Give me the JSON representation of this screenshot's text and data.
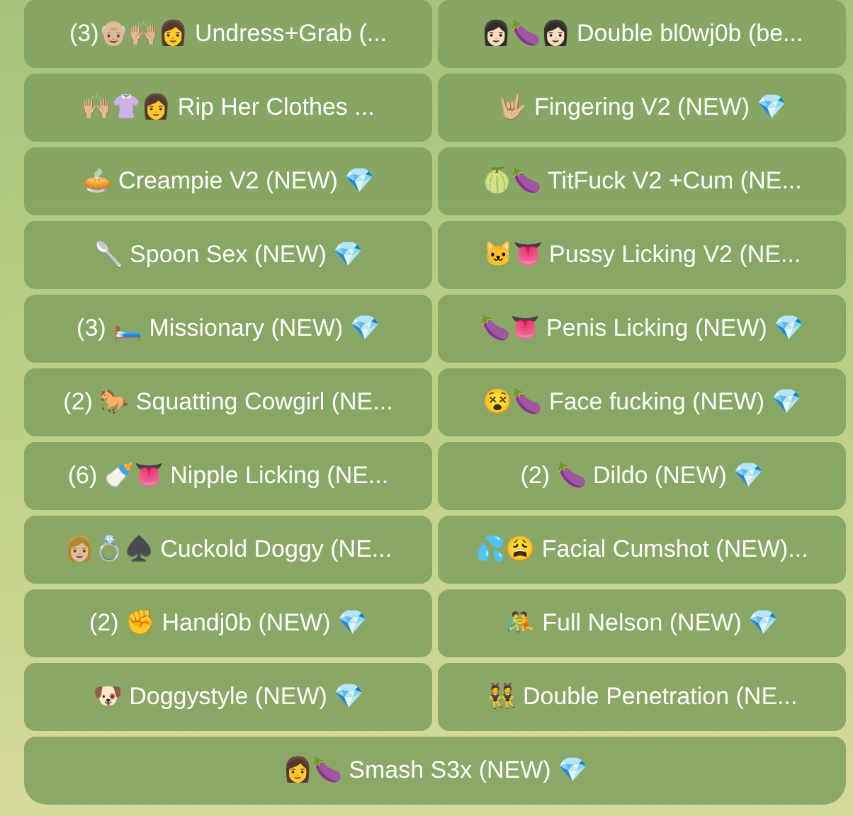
{
  "keyboard": [
    {
      "label": "(3)👴🏼🙌🏼👩 Undress+Grab (..."
    },
    {
      "label": "👩🏻🍆👩🏻 Double bl0wj0b (be..."
    },
    {
      "label": "🙌🏼👚👩 Rip Her Clothes ..."
    },
    {
      "label": "🤟🏼 Fingering V2 (NEW) 💎"
    },
    {
      "label": "🥧 Creampie V2 (NEW) 💎"
    },
    {
      "label": "🍈🍆 TitFuck V2 +Cum (NE..."
    },
    {
      "label": "🥄 Spoon Sex (NEW) 💎"
    },
    {
      "label": "🐱👅 Pussy Licking V2 (NE..."
    },
    {
      "label": "(3) 🛏️ Missionary (NEW) 💎"
    },
    {
      "label": "🍆👅 Penis Licking (NEW) 💎"
    },
    {
      "label": "(2) 🐎 Squatting Cowgirl (NE..."
    },
    {
      "label": "😵🍆 Face fucking (NEW) 💎"
    },
    {
      "label": "(6) 🍼👅 Nipple Licking (NE..."
    },
    {
      "label": "(2) 🍆 Dildo (NEW) 💎"
    },
    {
      "label": "👩🏼💍♠️ Cuckold Doggy (NE..."
    },
    {
      "label": "💦😩 Facial Cumshot (NEW)..."
    },
    {
      "label": "(2) ✊ Handj0b (NEW) 💎"
    },
    {
      "label": "🤼 Full Nelson (NEW) 💎"
    },
    {
      "label": "🐶 Doggystyle (NEW) 💎"
    },
    {
      "label": "👯 Double Penetration (NE..."
    },
    {
      "label": "👩🍆 Smash S3x (NEW) 💎"
    }
  ]
}
